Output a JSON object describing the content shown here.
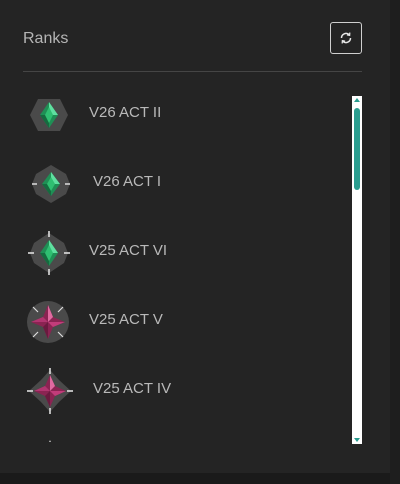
{
  "panel": {
    "title": "Ranks",
    "refresh_icon": "refresh-icon"
  },
  "ranks": [
    {
      "label": "V26 ACT II",
      "badge": "emerald-rank-badge",
      "color": "#2fbf71"
    },
    {
      "label": "V26 ACT I",
      "badge": "emerald-rank-badge",
      "color": "#2fbf71"
    },
    {
      "label": "V25 ACT VI",
      "badge": "emerald-rank-badge",
      "color": "#2fbf71"
    },
    {
      "label": "V25 ACT V",
      "badge": "diamond-rank-badge",
      "color": "#c23c7a"
    },
    {
      "label": "V25 ACT IV",
      "badge": "diamond-rank-badge",
      "color": "#c23c7a"
    }
  ],
  "colors": {
    "accent": "#2a9d8f",
    "emerald": "#2fbf71",
    "diamond": "#c23c7a"
  }
}
